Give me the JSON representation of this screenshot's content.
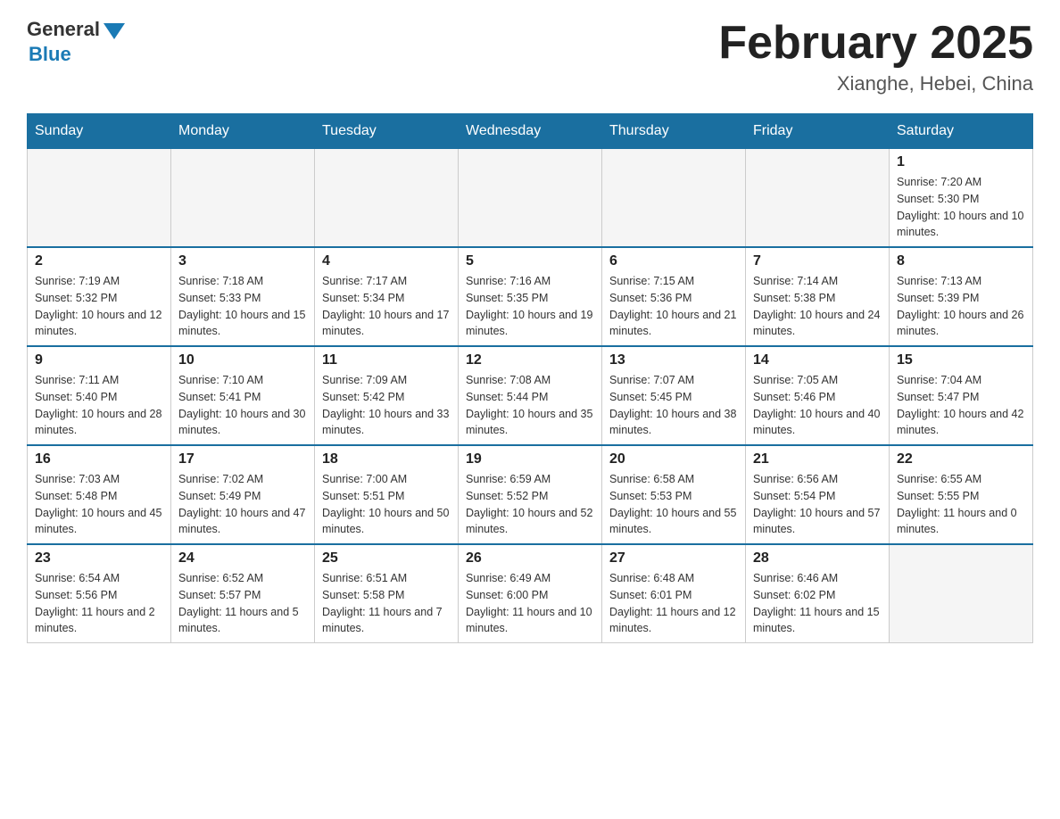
{
  "header": {
    "logo_general": "General",
    "logo_blue": "Blue",
    "month_title": "February 2025",
    "location": "Xianghe, Hebei, China"
  },
  "weekdays": [
    "Sunday",
    "Monday",
    "Tuesday",
    "Wednesday",
    "Thursday",
    "Friday",
    "Saturday"
  ],
  "weeks": [
    [
      {
        "day": "",
        "info": ""
      },
      {
        "day": "",
        "info": ""
      },
      {
        "day": "",
        "info": ""
      },
      {
        "day": "",
        "info": ""
      },
      {
        "day": "",
        "info": ""
      },
      {
        "day": "",
        "info": ""
      },
      {
        "day": "1",
        "info": "Sunrise: 7:20 AM\nSunset: 5:30 PM\nDaylight: 10 hours and 10 minutes."
      }
    ],
    [
      {
        "day": "2",
        "info": "Sunrise: 7:19 AM\nSunset: 5:32 PM\nDaylight: 10 hours and 12 minutes."
      },
      {
        "day": "3",
        "info": "Sunrise: 7:18 AM\nSunset: 5:33 PM\nDaylight: 10 hours and 15 minutes."
      },
      {
        "day": "4",
        "info": "Sunrise: 7:17 AM\nSunset: 5:34 PM\nDaylight: 10 hours and 17 minutes."
      },
      {
        "day": "5",
        "info": "Sunrise: 7:16 AM\nSunset: 5:35 PM\nDaylight: 10 hours and 19 minutes."
      },
      {
        "day": "6",
        "info": "Sunrise: 7:15 AM\nSunset: 5:36 PM\nDaylight: 10 hours and 21 minutes."
      },
      {
        "day": "7",
        "info": "Sunrise: 7:14 AM\nSunset: 5:38 PM\nDaylight: 10 hours and 24 minutes."
      },
      {
        "day": "8",
        "info": "Sunrise: 7:13 AM\nSunset: 5:39 PM\nDaylight: 10 hours and 26 minutes."
      }
    ],
    [
      {
        "day": "9",
        "info": "Sunrise: 7:11 AM\nSunset: 5:40 PM\nDaylight: 10 hours and 28 minutes."
      },
      {
        "day": "10",
        "info": "Sunrise: 7:10 AM\nSunset: 5:41 PM\nDaylight: 10 hours and 30 minutes."
      },
      {
        "day": "11",
        "info": "Sunrise: 7:09 AM\nSunset: 5:42 PM\nDaylight: 10 hours and 33 minutes."
      },
      {
        "day": "12",
        "info": "Sunrise: 7:08 AM\nSunset: 5:44 PM\nDaylight: 10 hours and 35 minutes."
      },
      {
        "day": "13",
        "info": "Sunrise: 7:07 AM\nSunset: 5:45 PM\nDaylight: 10 hours and 38 minutes."
      },
      {
        "day": "14",
        "info": "Sunrise: 7:05 AM\nSunset: 5:46 PM\nDaylight: 10 hours and 40 minutes."
      },
      {
        "day": "15",
        "info": "Sunrise: 7:04 AM\nSunset: 5:47 PM\nDaylight: 10 hours and 42 minutes."
      }
    ],
    [
      {
        "day": "16",
        "info": "Sunrise: 7:03 AM\nSunset: 5:48 PM\nDaylight: 10 hours and 45 minutes."
      },
      {
        "day": "17",
        "info": "Sunrise: 7:02 AM\nSunset: 5:49 PM\nDaylight: 10 hours and 47 minutes."
      },
      {
        "day": "18",
        "info": "Sunrise: 7:00 AM\nSunset: 5:51 PM\nDaylight: 10 hours and 50 minutes."
      },
      {
        "day": "19",
        "info": "Sunrise: 6:59 AM\nSunset: 5:52 PM\nDaylight: 10 hours and 52 minutes."
      },
      {
        "day": "20",
        "info": "Sunrise: 6:58 AM\nSunset: 5:53 PM\nDaylight: 10 hours and 55 minutes."
      },
      {
        "day": "21",
        "info": "Sunrise: 6:56 AM\nSunset: 5:54 PM\nDaylight: 10 hours and 57 minutes."
      },
      {
        "day": "22",
        "info": "Sunrise: 6:55 AM\nSunset: 5:55 PM\nDaylight: 11 hours and 0 minutes."
      }
    ],
    [
      {
        "day": "23",
        "info": "Sunrise: 6:54 AM\nSunset: 5:56 PM\nDaylight: 11 hours and 2 minutes."
      },
      {
        "day": "24",
        "info": "Sunrise: 6:52 AM\nSunset: 5:57 PM\nDaylight: 11 hours and 5 minutes."
      },
      {
        "day": "25",
        "info": "Sunrise: 6:51 AM\nSunset: 5:58 PM\nDaylight: 11 hours and 7 minutes."
      },
      {
        "day": "26",
        "info": "Sunrise: 6:49 AM\nSunset: 6:00 PM\nDaylight: 11 hours and 10 minutes."
      },
      {
        "day": "27",
        "info": "Sunrise: 6:48 AM\nSunset: 6:01 PM\nDaylight: 11 hours and 12 minutes."
      },
      {
        "day": "28",
        "info": "Sunrise: 6:46 AM\nSunset: 6:02 PM\nDaylight: 11 hours and 15 minutes."
      },
      {
        "day": "",
        "info": ""
      }
    ]
  ]
}
